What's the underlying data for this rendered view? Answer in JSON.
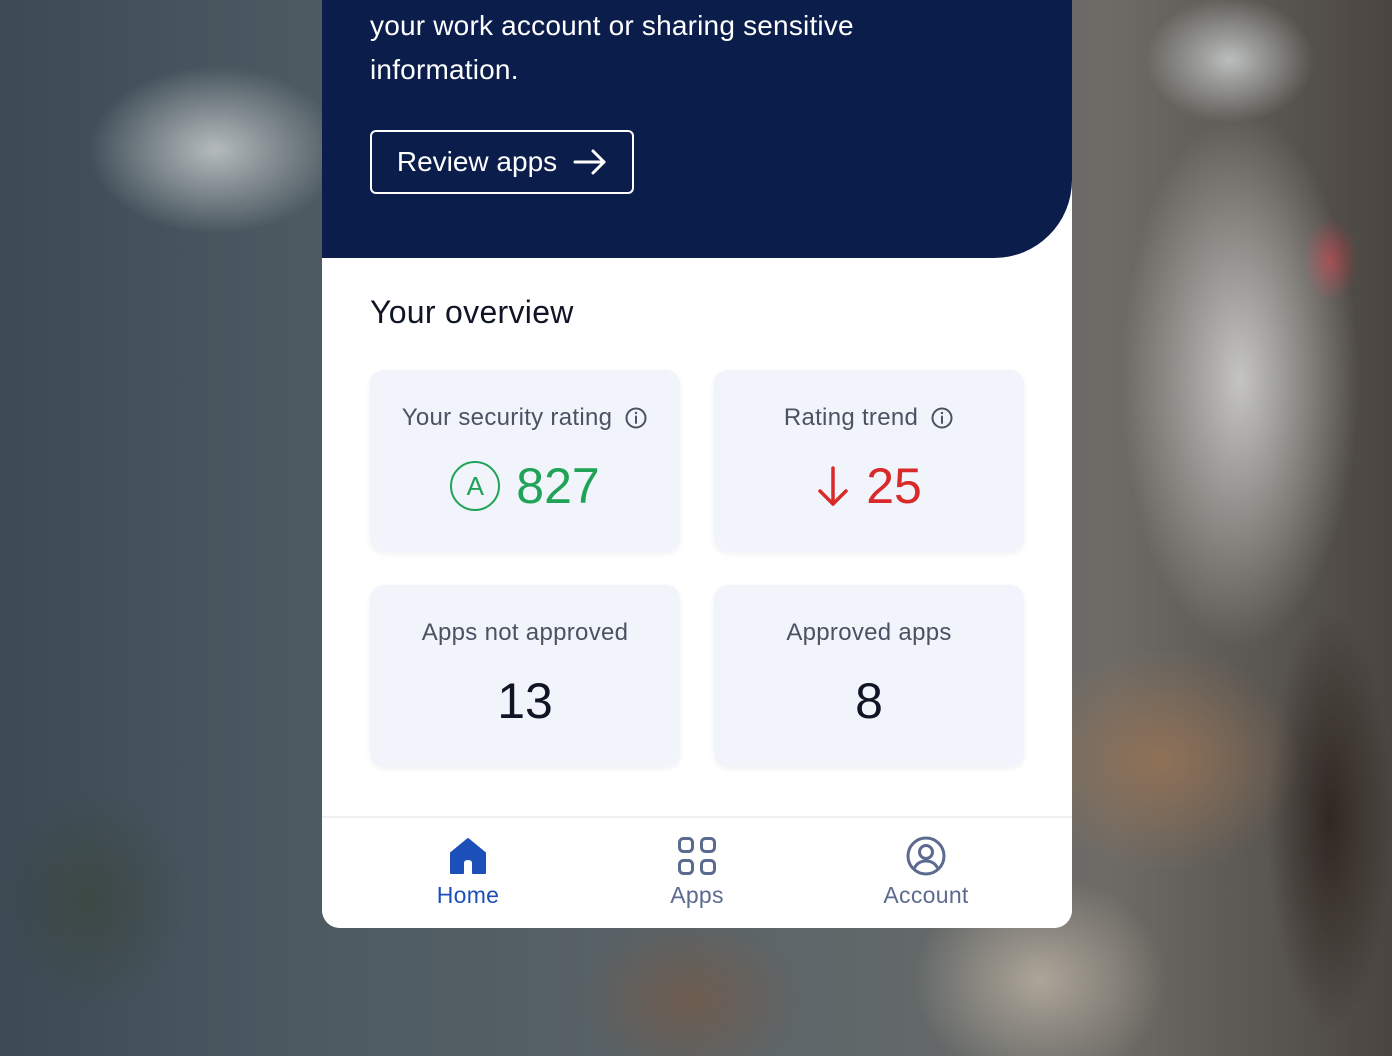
{
  "hero": {
    "text_line1": "your work account or sharing sensitive",
    "text_line2": "information.",
    "review_button_label": "Review apps"
  },
  "overview": {
    "title": "Your overview",
    "cards": [
      {
        "label": "Your security rating",
        "grade": "A",
        "value": "827",
        "value_color": "#1fa356",
        "icon": "info-icon"
      },
      {
        "label": "Rating trend",
        "value": "25",
        "direction": "down",
        "value_color": "#d92a2a",
        "icon": "info-icon"
      },
      {
        "label": "Apps not approved",
        "value": "13"
      },
      {
        "label": "Approved apps",
        "value": "8"
      }
    ]
  },
  "nav": {
    "items": [
      {
        "label": "Home",
        "icon": "home-icon",
        "active": true
      },
      {
        "label": "Apps",
        "icon": "apps-grid-icon",
        "active": false
      },
      {
        "label": "Account",
        "icon": "account-icon",
        "active": false
      }
    ]
  },
  "colors": {
    "hero_bg": "#0b1d4b",
    "accent": "#1d4fb8",
    "positive": "#1fa356",
    "negative": "#d92a2a",
    "card_bg": "#f1f4fa"
  }
}
